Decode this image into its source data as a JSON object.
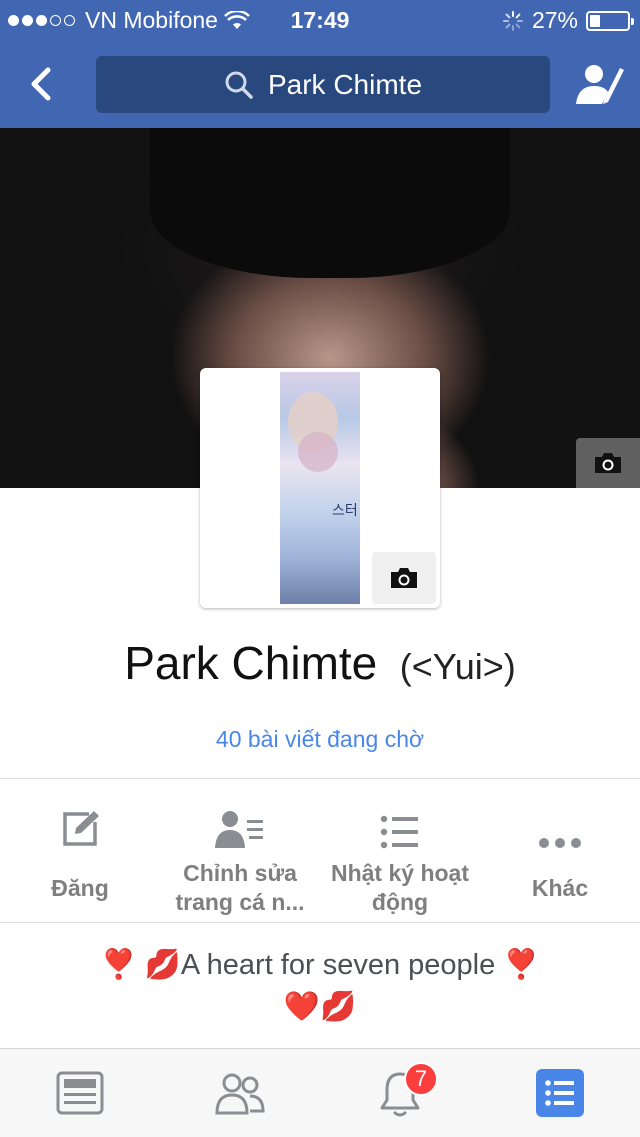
{
  "status_bar": {
    "carrier": "VN Mobifone",
    "time": "17:49",
    "battery": "27%",
    "battery_level": 0.27,
    "signal_dots_filled": 3,
    "signal_dots_total": 5
  },
  "nav": {
    "search_text": "Park Chimte",
    "back_icon": "chevron-left-icon",
    "edit_icon": "person-edit-icon"
  },
  "profile": {
    "name": "Park Chimte",
    "alternate_name": "(<Yui>)",
    "photo_text": "스터",
    "pending_posts": "40 bài viết đang chờ"
  },
  "actions": [
    {
      "label": "Đăng",
      "icon": "compose-icon"
    },
    {
      "label": "Chỉnh sửa trang cá n...",
      "icon": "edit-profile-icon"
    },
    {
      "label": "Nhật ký hoạt động",
      "icon": "activity-log-icon"
    },
    {
      "label": "Khác",
      "icon": "more-icon"
    }
  ],
  "bio": {
    "line1": "❣️ 💋A heart for seven people  ❣️",
    "line2": "❤️💋"
  },
  "tab_bar": {
    "notifications_badge": "7",
    "tabs": [
      "news-feed-icon",
      "friends-icon",
      "notifications-icon",
      "menu-icon"
    ]
  },
  "colors": {
    "brand_blue": "#4267b2",
    "search_bg": "#29487d",
    "link_blue": "#4a86e8",
    "badge_red": "#fa3e3e",
    "active_tab": "#4a86e8"
  }
}
